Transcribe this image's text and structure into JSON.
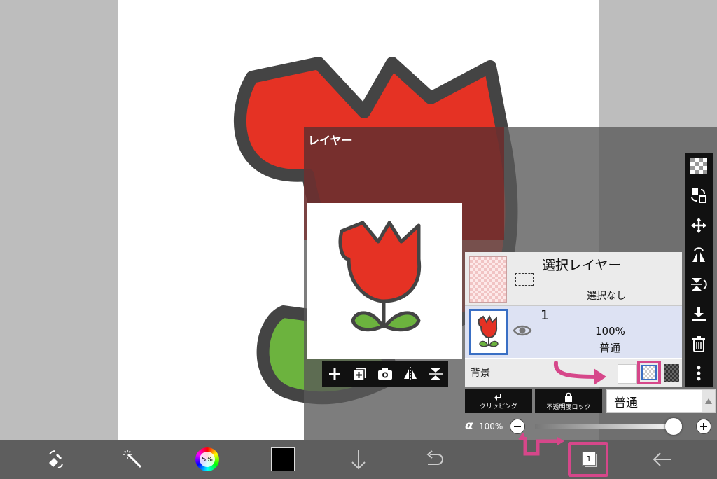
{
  "layer_panel": {
    "title": "レイヤー",
    "selection_layer": {
      "name": "選択レイヤー",
      "status": "選択なし"
    },
    "layer1": {
      "number": "1",
      "opacity": "100%",
      "blend": "普通"
    },
    "background": {
      "label": "背景"
    },
    "clipping_label": "クリッピング",
    "alpha_lock_label": "不透明度ロック",
    "blend_mode_value": "普通",
    "alpha_symbol": "α",
    "opacity_value": "100%",
    "opacity_fraction": 1.0
  },
  "bottom_bar": {
    "brush_size": "5%",
    "layer_count": "1"
  },
  "colors": {
    "tulip_red": "#e53224",
    "leaf_green": "#6cb33e",
    "outline": "#444444",
    "annotation_pink": "#d6478a",
    "highlight_blue": "#3a6fc4",
    "current_color": "#000000"
  },
  "icons": [
    "transform-icon",
    "magic-wand-icon",
    "color-wheel-icon",
    "color-swatch-icon",
    "arrow-down-icon",
    "undo-icon",
    "layers-icon",
    "back-arrow-icon",
    "add-layer-icon",
    "add-copy-layer-icon",
    "camera-icon",
    "flip-horizontal-icon",
    "flip-vertical-icon",
    "transparency-icon",
    "swap-icon",
    "move-icon",
    "merge-down-icon",
    "trash-icon",
    "more-icon",
    "eye-icon",
    "lock-icon",
    "clip-icon"
  ]
}
